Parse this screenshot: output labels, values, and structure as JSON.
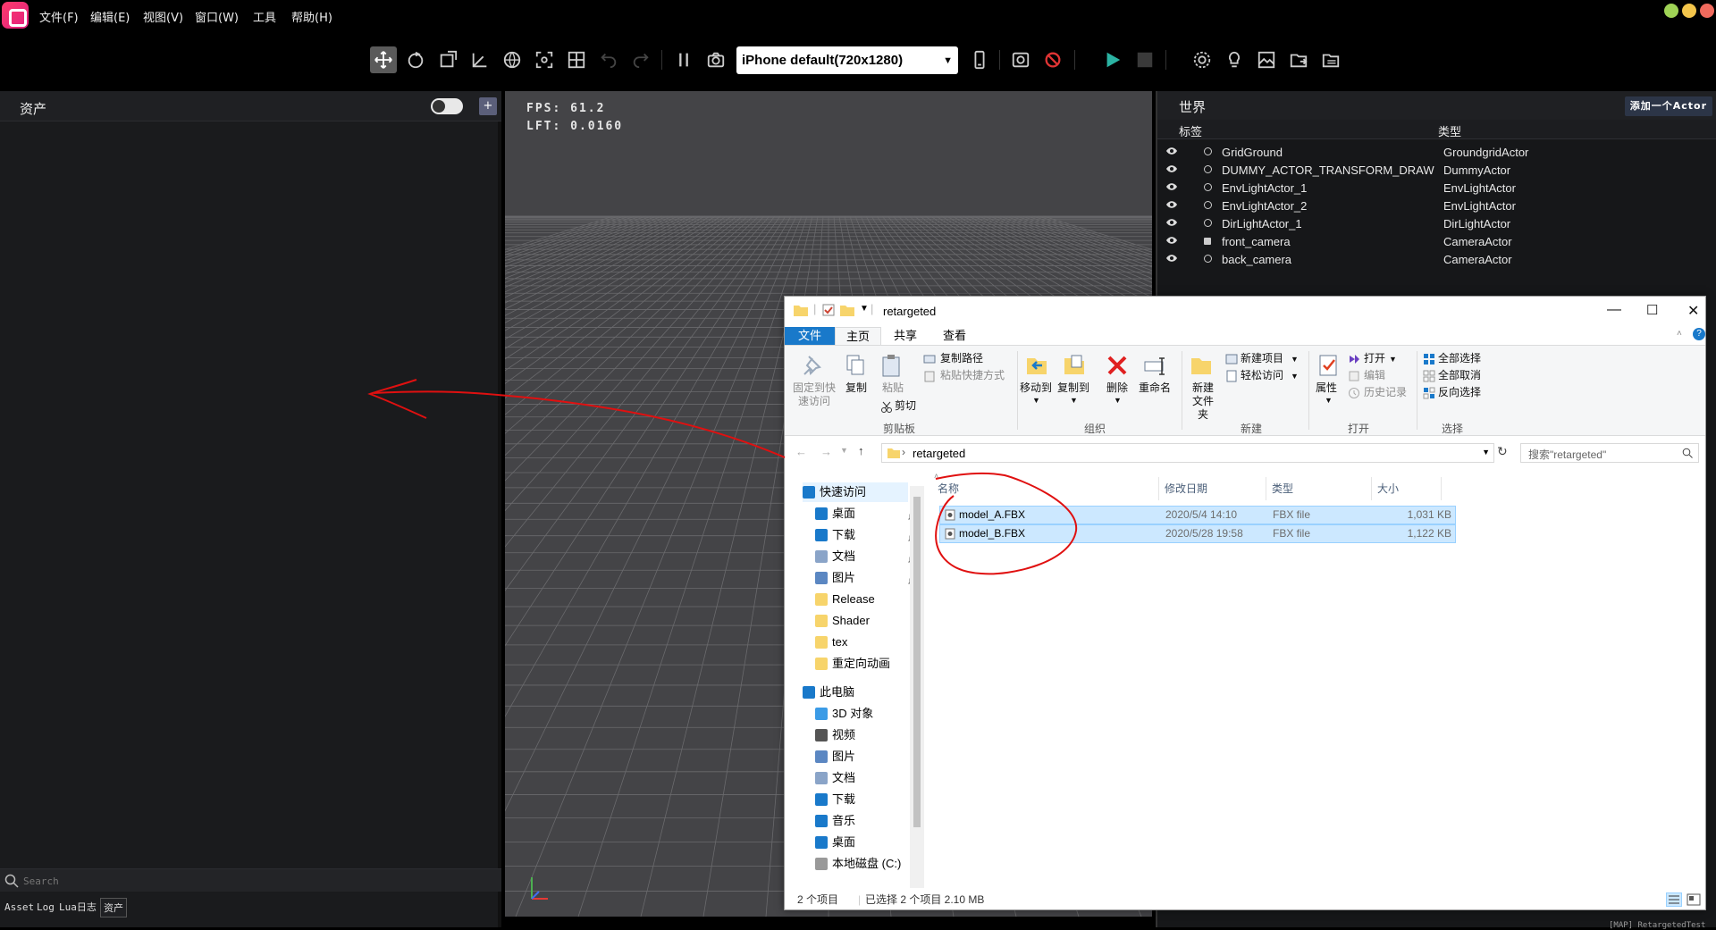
{
  "menu": [
    "文件(F)",
    "编辑(E)",
    "视图(V)",
    "窗口(W)",
    "工具",
    "帮助(H)"
  ],
  "toolbar": {
    "device": "iPhone default(720x1280)"
  },
  "assets": {
    "title": "资产",
    "add": "+",
    "search_placeholder": "Search"
  },
  "bottom_tabs": [
    "Asset",
    "Log",
    "Lua日志",
    "资产"
  ],
  "viewport": {
    "fps_label": "FPS:",
    "fps_value": "61.2",
    "lft_label": "LFT:",
    "lft_value": "0.0160"
  },
  "world": {
    "title": "世界",
    "add_actor": "添加一个Actor",
    "col_label": "标签",
    "col_type": "类型",
    "actors": [
      {
        "name": "GridGround",
        "type": "GroundgridActor"
      },
      {
        "name": "DUMMY_ACTOR_TRANSFORM_DRAW",
        "type": "DummyActor"
      },
      {
        "name": "EnvLightActor_1",
        "type": "EnvLightActor"
      },
      {
        "name": "EnvLightActor_2",
        "type": "EnvLightActor"
      },
      {
        "name": "DirLightActor_1",
        "type": "DirLightActor"
      },
      {
        "name": "front_camera",
        "type": "CameraActor"
      },
      {
        "name": "back_camera",
        "type": "CameraActor"
      }
    ]
  },
  "explorer": {
    "title": "retargeted",
    "tabs": [
      "文件",
      "主页",
      "共享",
      "查看"
    ],
    "ribbon": {
      "pin": "固定到快速访问",
      "copy": "复制",
      "paste": "粘贴",
      "copy_path": "复制路径",
      "paste_shortcut": "粘贴快捷方式",
      "cut": "剪切",
      "clipboard": "剪贴板",
      "move_to": "移动到",
      "copy_to": "复制到",
      "delete": "删除",
      "rename": "重命名",
      "organize": "组织",
      "new_folder": "新建文件夹",
      "new_item": "新建项目",
      "easy_access": "轻松访问",
      "new": "新建",
      "properties": "属性",
      "open": "打开",
      "edit": "编辑",
      "history": "历史记录",
      "open_group": "打开",
      "select_all": "全部选择",
      "select_none": "全部取消",
      "invert": "反向选择",
      "select": "选择"
    },
    "address": "retargeted",
    "search_placeholder": "搜索\"retargeted\"",
    "nav": {
      "quick": "快速访问",
      "quick_items": [
        "桌面",
        "下载",
        "文档",
        "图片",
        "Release",
        "Shader",
        "tex",
        "重定向动画"
      ],
      "pc": "此电脑",
      "pc_items": [
        "3D 对象",
        "视频",
        "图片",
        "文档",
        "下载",
        "音乐",
        "桌面",
        "本地磁盘 (C:)"
      ]
    },
    "columns": [
      "名称",
      "修改日期",
      "类型",
      "大小"
    ],
    "files": [
      {
        "name": "model_A.FBX",
        "date": "2020/5/4 14:10",
        "type": "FBX file",
        "size": "1,031 KB"
      },
      {
        "name": "model_B.FBX",
        "date": "2020/5/28 19:58",
        "type": "FBX file",
        "size": "1,122 KB"
      }
    ],
    "status_count": "2 个项目",
    "status_selected": "已选择 2 个项目  2.10 MB"
  },
  "map_label": "[MAP] RetargetedTest"
}
